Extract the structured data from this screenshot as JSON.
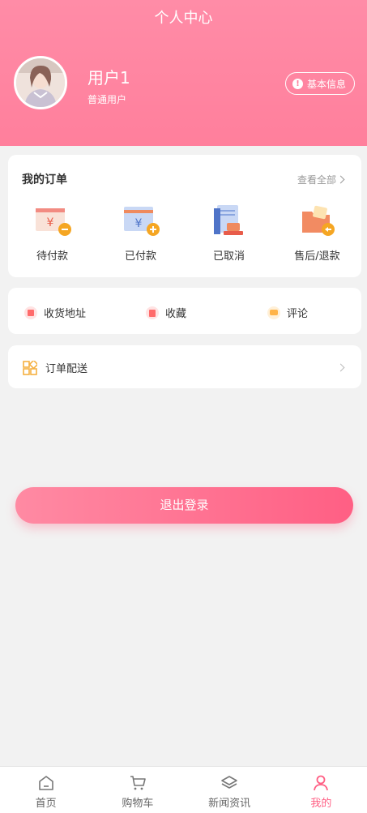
{
  "header": {
    "title": "个人中心",
    "user_name": "用户1",
    "user_role": "普通用户",
    "info_button": "基本信息"
  },
  "orders": {
    "title": "我的订单",
    "view_all": "查看全部",
    "items": [
      {
        "label": "待付款",
        "icon": "pending-payment-icon"
      },
      {
        "label": "已付款",
        "icon": "paid-icon"
      },
      {
        "label": "已取消",
        "icon": "cancelled-icon"
      },
      {
        "label": "售后/退款",
        "icon": "after-sales-icon"
      }
    ]
  },
  "services": [
    {
      "label": "收货地址",
      "icon": "address-icon",
      "color": "#ff6b6b"
    },
    {
      "label": "收藏",
      "icon": "favorite-icon",
      "color": "#ff6b6b"
    },
    {
      "label": "评论",
      "icon": "comment-icon",
      "color": "#ffb347"
    }
  ],
  "delivery": {
    "label": "订单配送"
  },
  "logout_label": "退出登录",
  "tabs": [
    {
      "label": "首页",
      "icon": "home-icon"
    },
    {
      "label": "购物车",
      "icon": "cart-icon"
    },
    {
      "label": "新闻资讯",
      "icon": "news-icon"
    },
    {
      "label": "我的",
      "icon": "user-icon"
    }
  ],
  "colors": {
    "accent": "#ff5f84",
    "header": "#ff8ca7"
  }
}
